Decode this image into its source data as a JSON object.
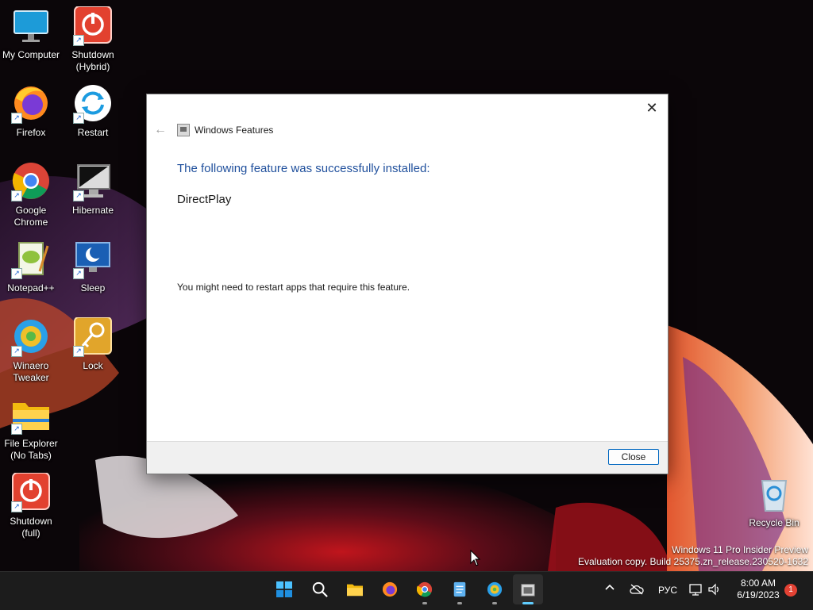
{
  "desktop": {
    "icons": [
      {
        "label": "My Computer",
        "icon": "monitor-icon"
      },
      {
        "label": "Shutdown\n(Hybrid)",
        "icon": "power-icon"
      },
      {
        "label": "Firefox",
        "icon": "firefox-icon"
      },
      {
        "label": "Restart",
        "icon": "restart-icon"
      },
      {
        "label": "Google\nChrome",
        "icon": "chrome-icon"
      },
      {
        "label": "Hibernate",
        "icon": "hibernate-icon"
      },
      {
        "label": "Notepad++",
        "icon": "notepadpp-icon"
      },
      {
        "label": "Sleep",
        "icon": "sleep-icon"
      },
      {
        "label": "Winaero\nTweaker",
        "icon": "winaero-icon"
      },
      {
        "label": "Lock",
        "icon": "lock-key-icon"
      },
      {
        "label": "File Explorer\n(No Tabs)",
        "icon": "folder-icon"
      },
      {
        "label": "Shutdown\n(full)",
        "icon": "power-icon"
      },
      {
        "label": "Recycle Bin",
        "icon": "recycle-bin-icon"
      }
    ]
  },
  "dialog": {
    "title": "Windows Features",
    "close_glyph": "✕",
    "heading": "The following feature was successfully installed:",
    "feature": "DirectPlay",
    "note": "You might need to restart apps that require this feature.",
    "close_button": "Close"
  },
  "watermark": {
    "line1": "Windows 11 Pro Insider Preview",
    "line2": "Evaluation copy. Build 25375.zn_release.230520-1632"
  },
  "taskbar": {
    "apps": [
      "start-icon",
      "search-icon",
      "file-explorer-icon",
      "firefox-icon",
      "chrome-icon",
      "notepad-icon",
      "winaero-icon",
      "windows-features-icon"
    ],
    "language": "РУС",
    "time": "8:00 AM",
    "date": "6/19/2023",
    "notifications": "1"
  },
  "colors": {
    "heading": "#1f4f9c",
    "accent": "#0067c0",
    "taskbar": "#1c1c1c"
  }
}
